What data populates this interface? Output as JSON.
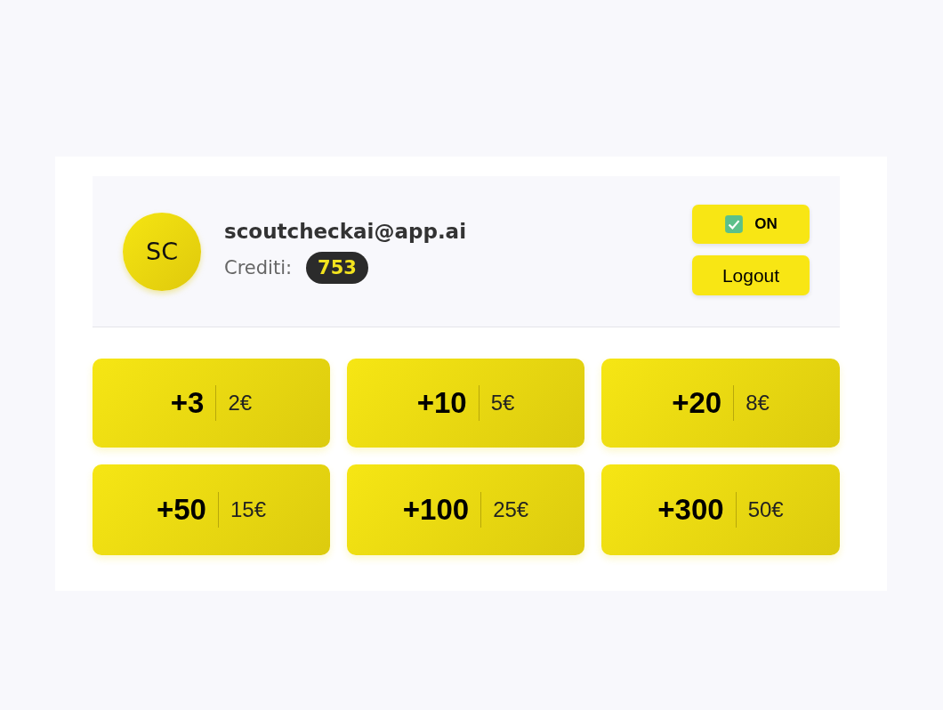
{
  "user": {
    "initials": "SC",
    "email": "scoutcheckai@app.ai",
    "credits_label": "Crediti:",
    "credits": "753"
  },
  "toggle": {
    "label": "ON",
    "on": true
  },
  "logout": {
    "label": "Logout"
  },
  "packages": [
    {
      "amount": "+3",
      "price": "2€"
    },
    {
      "amount": "+10",
      "price": "5€"
    },
    {
      "amount": "+20",
      "price": "8€"
    },
    {
      "amount": "+50",
      "price": "15€"
    },
    {
      "amount": "+100",
      "price": "25€"
    },
    {
      "amount": "+300",
      "price": "50€"
    }
  ]
}
